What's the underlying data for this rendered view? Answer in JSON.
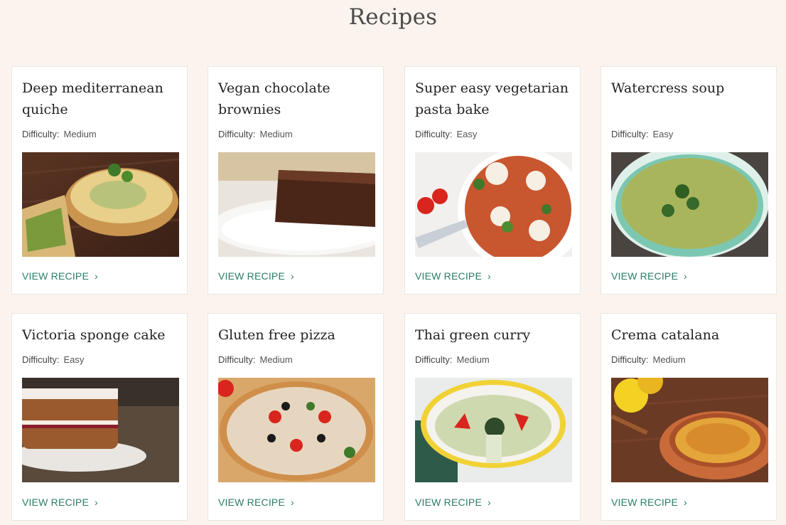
{
  "page": {
    "title": "Recipes"
  },
  "labels": {
    "difficulty": "Difficulty:",
    "view": "VIEW RECIPE",
    "chevron": "›"
  },
  "recipes": [
    {
      "title": "Deep mediterranean quiche",
      "difficulty": "Medium",
      "image": "quiche-photo"
    },
    {
      "title": "Vegan chocolate brownies",
      "difficulty": "Medium",
      "image": "brownie-photo"
    },
    {
      "title": "Super easy vegetarian pasta bake",
      "difficulty": "Easy",
      "image": "pasta-bake-photo"
    },
    {
      "title": "Watercress soup",
      "difficulty": "Easy",
      "image": "soup-photo"
    },
    {
      "title": "Victoria sponge cake",
      "difficulty": "Easy",
      "image": "sponge-cake-photo"
    },
    {
      "title": "Gluten free pizza",
      "difficulty": "Medium",
      "image": "pizza-photo"
    },
    {
      "title": "Thai green curry",
      "difficulty": "Medium",
      "image": "curry-photo"
    },
    {
      "title": "Crema catalana",
      "difficulty": "Medium",
      "image": "crema-catalana-photo"
    }
  ],
  "colors": {
    "background": "#fbf4ee",
    "link": "#2a7d68"
  }
}
